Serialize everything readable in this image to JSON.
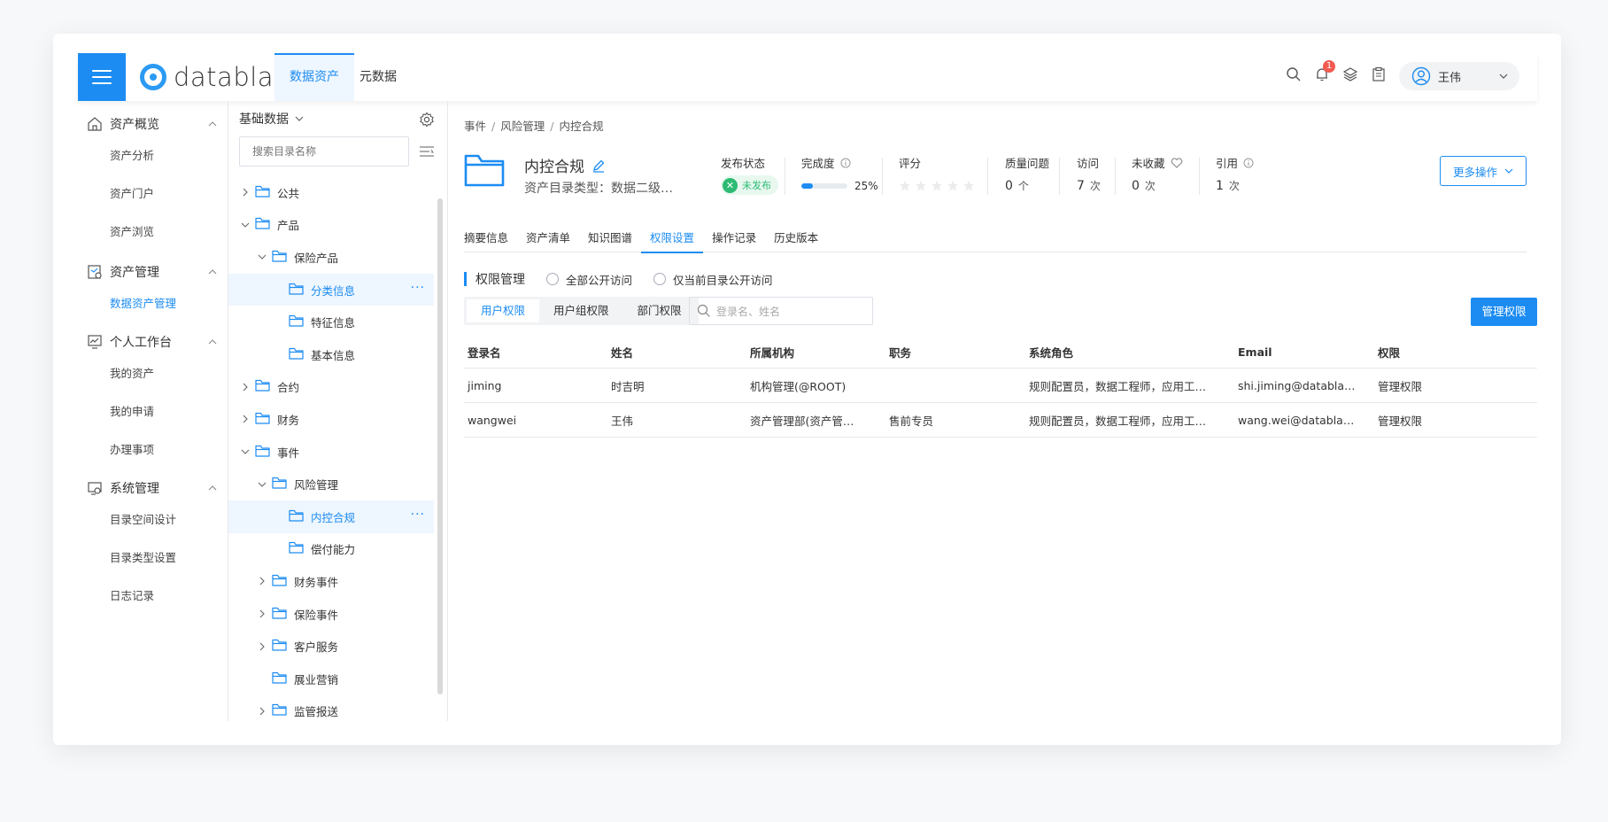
{
  "app": {
    "logo_text": "datablau",
    "brand_color": "#1c8cf2"
  },
  "header": {
    "tabs": [
      {
        "label": "数据资产",
        "active": true
      },
      {
        "label": "元数据",
        "active": false
      }
    ],
    "notification_count": "1",
    "user_name": "王伟",
    "icons": [
      "search-icon",
      "bell-icon",
      "layers-icon",
      "clipboard-icon",
      "user-icon",
      "chevron-down-icon"
    ]
  },
  "sidebar": {
    "groups": [
      {
        "label": "资产概览",
        "icon": "home-icon",
        "items": [
          "资产分析",
          "资产门户",
          "资产浏览"
        ]
      },
      {
        "label": "资产管理",
        "icon": "asset-manage-icon",
        "items": [
          "数据资产管理"
        ]
      },
      {
        "label": "个人工作台",
        "icon": "workbench-icon",
        "items": [
          "我的资产",
          "我的申请",
          "办理事项"
        ]
      },
      {
        "label": "系统管理",
        "icon": "system-icon",
        "items": [
          "目录空间设计",
          "目录类型设置",
          "日志记录"
        ]
      }
    ],
    "active_item": "数据资产管理"
  },
  "tree": {
    "title": "基础数据",
    "search_placeholder": "搜索目录名称",
    "nodes": [
      {
        "label": "公共",
        "level": 0,
        "caret": "right"
      },
      {
        "label": "产品",
        "level": 0,
        "caret": "down"
      },
      {
        "label": "保险产品",
        "level": 1,
        "caret": "down"
      },
      {
        "label": "分类信息",
        "level": 2,
        "caret": "none",
        "hover": true
      },
      {
        "label": "特征信息",
        "level": 2,
        "caret": "none"
      },
      {
        "label": "基本信息",
        "level": 2,
        "caret": "none"
      },
      {
        "label": "合约",
        "level": 0,
        "caret": "right"
      },
      {
        "label": "财务",
        "level": 0,
        "caret": "right"
      },
      {
        "label": "事件",
        "level": 0,
        "caret": "down"
      },
      {
        "label": "风险管理",
        "level": 1,
        "caret": "down"
      },
      {
        "label": "内控合规",
        "level": 2,
        "caret": "none",
        "selected": true
      },
      {
        "label": "偿付能力",
        "level": 2,
        "caret": "none"
      },
      {
        "label": "财务事件",
        "level": 1,
        "caret": "right"
      },
      {
        "label": "保险事件",
        "level": 1,
        "caret": "right"
      },
      {
        "label": "客户服务",
        "level": 1,
        "caret": "right"
      },
      {
        "label": "展业营销",
        "level": 1,
        "caret": "none"
      },
      {
        "label": "监管报送",
        "level": 1,
        "caret": "right"
      }
    ],
    "more_glyph": "···"
  },
  "main": {
    "breadcrumb": [
      "事件",
      "风险管理",
      "内控合规"
    ],
    "asset": {
      "title": "内控合规",
      "subtitle": "资产目录类型：数据二级…",
      "publish_label": "发布状态",
      "publish_status": "未发布",
      "completion_label": "完成度",
      "completion_pct": "25%",
      "completion_value": 25,
      "rating_label": "评分",
      "rating_value": 0,
      "quality_label": "质量问题",
      "quality_value": "0",
      "quality_unit": "个",
      "visit_label": "访问",
      "visit_value": "7",
      "visit_unit": "次",
      "fav_label": "未收藏",
      "fav_value": "0",
      "fav_unit": "次",
      "ref_label": "引用",
      "ref_value": "1",
      "ref_unit": "次",
      "more_actions": "更多操作"
    },
    "tabs": [
      {
        "label": "摘要信息",
        "active": false
      },
      {
        "label": "资产清单",
        "active": false
      },
      {
        "label": "知识图谱",
        "active": false
      },
      {
        "label": "权限设置",
        "active": true
      },
      {
        "label": "操作记录",
        "active": false
      },
      {
        "label": "历史版本",
        "active": false
      }
    ],
    "permission": {
      "title": "权限管理",
      "radio_all": "全部公开访问",
      "radio_current": "仅当前目录公开访问",
      "subtabs": [
        {
          "label": "用户权限",
          "active": true
        },
        {
          "label": "用户组权限",
          "active": false
        },
        {
          "label": "部门权限",
          "active": false
        }
      ],
      "search_placeholder": "登录名、姓名",
      "manage_button": "管理权限"
    },
    "table": {
      "columns": [
        "登录名",
        "姓名",
        "所属机构",
        "职务",
        "系统角色",
        "Email",
        "权限"
      ],
      "rows": [
        [
          "jiming",
          "时吉明",
          "机构管理(@ROOT)",
          "",
          "规则配置员，数据工程师，应用工…",
          "shi.jiming@databla…",
          "管理权限"
        ],
        [
          "wangwei",
          "王伟",
          "资产管理部(资产管…",
          "售前专员",
          "规则配置员，数据工程师，应用工…",
          "wang.wei@databla…",
          "管理权限"
        ]
      ]
    }
  }
}
